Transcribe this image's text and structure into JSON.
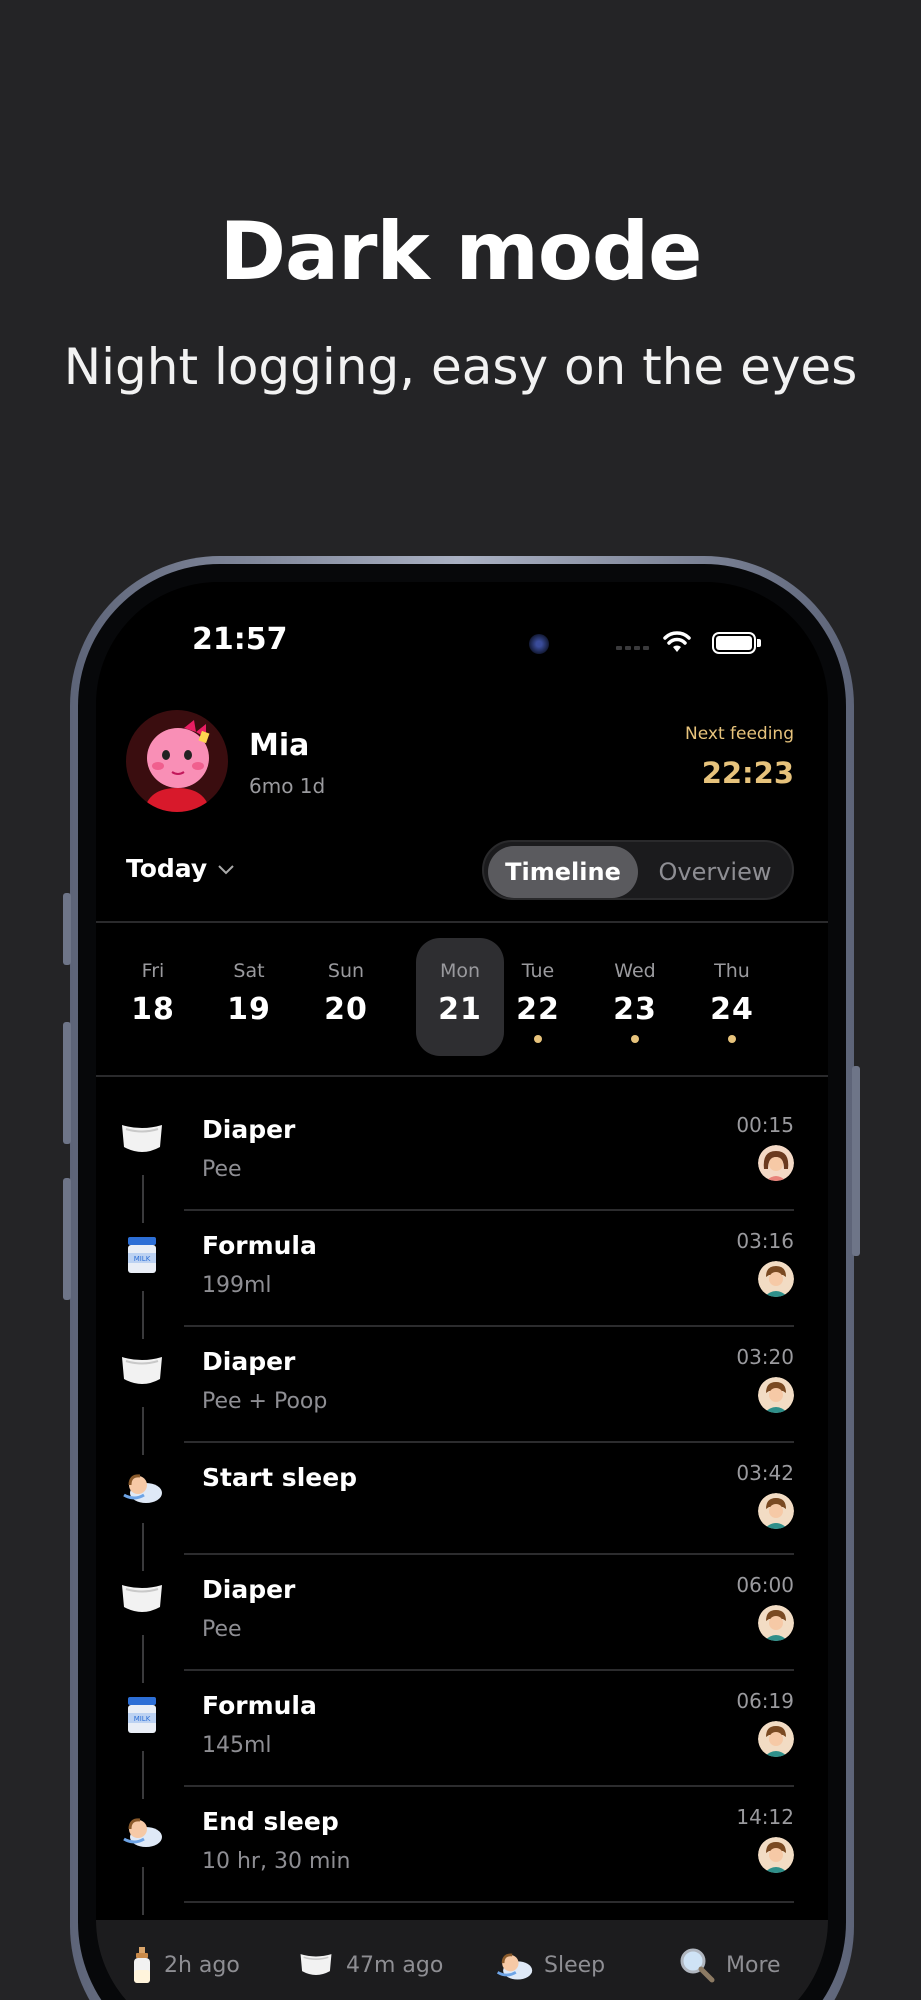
{
  "promo": {
    "title": "Dark mode",
    "subtitle": "Night logging, easy on the eyes"
  },
  "status_bar": {
    "time": "21:57"
  },
  "profile": {
    "name": "Mia",
    "age": "6mo 1d",
    "next_feeding_label": "Next feeding",
    "next_feeding_time": "22:23"
  },
  "controls": {
    "date_filter": "Today",
    "segments": [
      "Timeline",
      "Overview"
    ],
    "active_segment": "Timeline"
  },
  "week": [
    {
      "name": "Fri",
      "date": "18",
      "selected": false,
      "has_dot": false
    },
    {
      "name": "Sat",
      "date": "19",
      "selected": false,
      "has_dot": false
    },
    {
      "name": "Sun",
      "date": "20",
      "selected": false,
      "has_dot": false
    },
    {
      "name": "Mon",
      "date": "21",
      "selected": true,
      "has_dot": false
    },
    {
      "name": "Tue",
      "date": "22",
      "selected": false,
      "has_dot": true
    },
    {
      "name": "Wed",
      "date": "23",
      "selected": false,
      "has_dot": true
    },
    {
      "name": "Thu",
      "date": "24",
      "selected": false,
      "has_dot": true
    }
  ],
  "events": [
    {
      "icon": "diaper-icon",
      "title": "Diaper",
      "detail": "Pee",
      "time": "00:15",
      "user": "mom-avatar"
    },
    {
      "icon": "formula-icon",
      "title": "Formula",
      "detail": "199ml",
      "time": "03:16",
      "user": "dad-avatar"
    },
    {
      "icon": "diaper-icon",
      "title": "Diaper",
      "detail": "Pee + Poop",
      "time": "03:20",
      "user": "dad-avatar"
    },
    {
      "icon": "sleep-icon",
      "title": "Start sleep",
      "detail": "",
      "time": "03:42",
      "user": "dad-avatar"
    },
    {
      "icon": "diaper-icon",
      "title": "Diaper",
      "detail": "Pee",
      "time": "06:00",
      "user": "dad-avatar"
    },
    {
      "icon": "formula-icon",
      "title": "Formula",
      "detail": "145ml",
      "time": "06:19",
      "user": "dad-avatar"
    },
    {
      "icon": "sleep-icon",
      "title": "End sleep",
      "detail": "10 hr, 30 min",
      "time": "14:12",
      "user": "dad-avatar"
    }
  ],
  "tabbar": [
    {
      "icon": "bottle-icon",
      "label": "2h ago"
    },
    {
      "icon": "diaper-icon",
      "label": "47m ago"
    },
    {
      "icon": "sleep-icon",
      "label": "Sleep"
    },
    {
      "icon": "search-icon",
      "label": "More"
    }
  ],
  "colors": {
    "background": "#242426",
    "screen": "#000000",
    "accent": "#e7c37c",
    "selected_day": "#2e2e31"
  }
}
